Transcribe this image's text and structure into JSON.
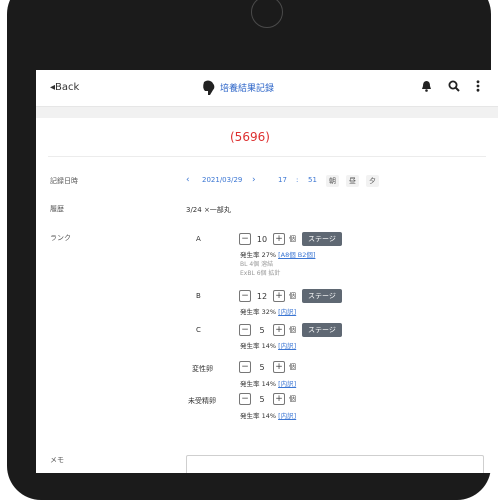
{
  "appbar": {
    "back": "◂Back",
    "title": "培養結果記録"
  },
  "counter": "(5696)",
  "record_date": {
    "label": "記録日時",
    "prev": "‹",
    "date": "2021/03/29",
    "next": "›",
    "hour": "17",
    "sep": ":",
    "minute": "51",
    "periods": [
      "朝",
      "昼",
      "夕"
    ]
  },
  "origin": {
    "label": "履歴",
    "value": "3/24 ×一部丸"
  },
  "rank": {
    "label": "ランク",
    "unit": "個",
    "stage_label": "ステージ",
    "items": [
      {
        "name": "A",
        "count": "10",
        "rate_prefix": "発生率 27%",
        "rate_link": "[A8個 B2個]",
        "notes": [
          "BL 4個 溶結",
          "ExBL 6個 拡針"
        ]
      },
      {
        "name": "B",
        "count": "12",
        "rate_prefix": "発生率 32%",
        "rate_link": "[内訳]"
      },
      {
        "name": "C",
        "count": "5",
        "rate_prefix": "発生率 14%",
        "rate_link": "[内訳]"
      },
      {
        "name": "変性卵",
        "count": "5",
        "rate_prefix": "発生率 14%",
        "rate_link": "[内訳]"
      },
      {
        "name": "未受精卵",
        "count": "5",
        "rate_prefix": "発生率 14%",
        "rate_link": "[内訳]"
      }
    ]
  },
  "memo": {
    "label": "メモ"
  },
  "colors": {
    "accent": "#3b76d3",
    "counter": "#dd3030",
    "stage": "#5f6873"
  }
}
